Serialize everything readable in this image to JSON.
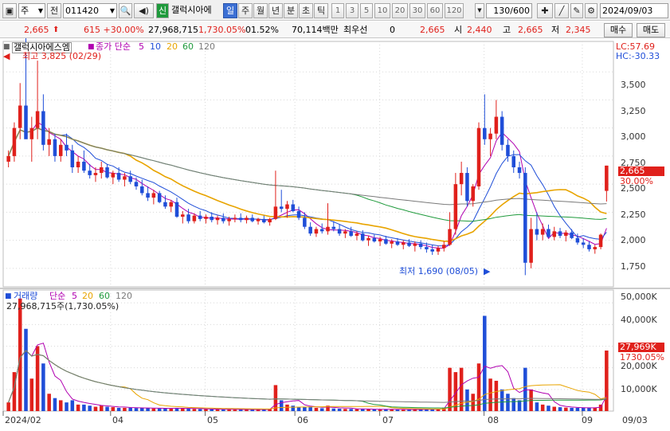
{
  "toolbar": {
    "market_type": "주",
    "market_label": "전",
    "code": "011420",
    "new_badge": "신",
    "name": "갤럭시아에",
    "period_tabs": [
      "일",
      "주",
      "월",
      "년",
      "분",
      "초",
      "틱"
    ],
    "active_period": "일",
    "intervals": [
      "1",
      "3",
      "5",
      "10",
      "20",
      "30",
      "60",
      "120"
    ],
    "page_counter": "130/600",
    "date": "2024/09/03"
  },
  "quote": {
    "price": "2,665",
    "change": "615 +30.00%",
    "volume": "27,968,715",
    "volume_ratio": "1,730.05%",
    "turnover_rate": "01.52%",
    "amount": "70,114백만",
    "pref_label": "최우선",
    "pref_value": "0",
    "ask": "2,665",
    "open_label": "시",
    "open": "2,440",
    "high_label": "고",
    "high": "2,665",
    "low_label": "저",
    "low": "2,345",
    "buy_label": "매수",
    "sell_label": "매도"
  },
  "price_pane": {
    "title": "갤럭시아에스엠",
    "indicator_label": "종가 단순",
    "ma_periods": [
      "5",
      "10",
      "20",
      "60",
      "120"
    ],
    "ma_colors": [
      "#b000b0",
      "#1f4ed8",
      "#e8a400",
      "#1f9a3c",
      "#7a7a7a"
    ],
    "lc": "LC:57.69",
    "hc": "HC:-30.33",
    "max_note": "최고 3,825 (02/29)",
    "min_note": "최저 1,690 (08/05)",
    "price_badge": "2,665",
    "pct_badge": "30.00%",
    "y_ticks": [
      "3,500",
      "3,250",
      "3,000",
      "2,750",
      "2,500",
      "2,250",
      "2,000",
      "1,750"
    ]
  },
  "volume_pane": {
    "title": "거래량",
    "indicator_label": "단순",
    "ma_periods": [
      "5",
      "20",
      "60",
      "120"
    ],
    "ma_colors": [
      "#b000b0",
      "#e8a400",
      "#1f9a3c",
      "#7a7a7a"
    ],
    "summary": "27,968,715주(1,730.05%)",
    "vol_badge": "27,969K",
    "vol_pct": "1730.05%",
    "y_ticks": [
      "50,000K",
      "40,000K",
      "30,000K",
      "20,000K",
      "10,000K"
    ]
  },
  "x_axis": {
    "labels": [
      "2024/02",
      "04",
      "05",
      "06",
      "07",
      "08",
      "09"
    ],
    "right_label": "09/03"
  },
  "colors": {
    "up": "#e0201b",
    "down": "#1f4ed8",
    "grid": "#d8d8d8",
    "badge": "#e0201b"
  },
  "chart_data": {
    "type": "candlestick",
    "price_range": [
      1600,
      3700
    ],
    "volume_range": [
      0,
      53000
    ],
    "candles": [
      [
        2700,
        2800,
        2650,
        2750,
        4000
      ],
      [
        2750,
        3050,
        2700,
        3000,
        18000
      ],
      [
        3000,
        3400,
        2900,
        3200,
        52000
      ],
      [
        3200,
        3825,
        3000,
        2900,
        38000
      ],
      [
        2900,
        3100,
        2700,
        3000,
        15000
      ],
      [
        3000,
        3600,
        2900,
        3150,
        30000
      ],
      [
        3150,
        3300,
        2800,
        2850,
        22000
      ],
      [
        2850,
        3000,
        2750,
        2900,
        8000
      ],
      [
        2900,
        2950,
        2700,
        2750,
        6000
      ],
      [
        2750,
        2900,
        2700,
        2850,
        5000
      ],
      [
        2850,
        2950,
        2750,
        2800,
        4000
      ],
      [
        2800,
        2850,
        2600,
        2650,
        5000
      ],
      [
        2650,
        2750,
        2600,
        2700,
        3000
      ],
      [
        2700,
        2800,
        2600,
        2620,
        3000
      ],
      [
        2620,
        2680,
        2550,
        2580,
        2500
      ],
      [
        2580,
        2650,
        2520,
        2600,
        2000
      ],
      [
        2600,
        2700,
        2550,
        2650,
        2500
      ],
      [
        2650,
        2680,
        2550,
        2560,
        2000
      ],
      [
        2560,
        2620,
        2500,
        2600,
        1800
      ],
      [
        2600,
        2650,
        2520,
        2540,
        1500
      ],
      [
        2540,
        2600,
        2480,
        2570,
        1500
      ],
      [
        2570,
        2620,
        2500,
        2520,
        1500
      ],
      [
        2520,
        2560,
        2450,
        2480,
        1400
      ],
      [
        2480,
        2540,
        2400,
        2420,
        1500
      ],
      [
        2420,
        2480,
        2350,
        2380,
        1300
      ],
      [
        2380,
        2450,
        2320,
        2420,
        1200
      ],
      [
        2420,
        2440,
        2330,
        2340,
        1200
      ],
      [
        2340,
        2400,
        2280,
        2300,
        1300
      ],
      [
        2300,
        2360,
        2250,
        2340,
        1200
      ],
      [
        2340,
        2380,
        2200,
        2210,
        1500
      ],
      [
        2210,
        2260,
        2150,
        2230,
        1200
      ],
      [
        2230,
        2280,
        2150,
        2170,
        1100
      ],
      [
        2170,
        2240,
        2150,
        2220,
        1000
      ],
      [
        2220,
        2260,
        2170,
        2190,
        900
      ],
      [
        2190,
        2230,
        2150,
        2210,
        900
      ],
      [
        2210,
        2250,
        2160,
        2180,
        900
      ],
      [
        2180,
        2220,
        2140,
        2200,
        800
      ],
      [
        2200,
        2240,
        2150,
        2170,
        800
      ],
      [
        2170,
        2210,
        2130,
        2190,
        800
      ],
      [
        2190,
        2230,
        2160,
        2200,
        700
      ],
      [
        2200,
        2240,
        2160,
        2180,
        700
      ],
      [
        2180,
        2220,
        2150,
        2200,
        700
      ],
      [
        2200,
        2230,
        2160,
        2170,
        700
      ],
      [
        2170,
        2200,
        2140,
        2190,
        700
      ],
      [
        2190,
        2220,
        2150,
        2160,
        800
      ],
      [
        2160,
        2200,
        2130,
        2190,
        900
      ],
      [
        2190,
        2620,
        2180,
        2300,
        12000
      ],
      [
        2300,
        2450,
        2250,
        2280,
        5000
      ],
      [
        2280,
        2350,
        2200,
        2320,
        3000
      ],
      [
        2320,
        2360,
        2250,
        2260,
        2500
      ],
      [
        2260,
        2300,
        2180,
        2200,
        2000
      ],
      [
        2200,
        2250,
        2100,
        2120,
        2000
      ],
      [
        2120,
        2160,
        2040,
        2060,
        2000
      ],
      [
        2060,
        2120,
        2030,
        2100,
        1500
      ],
      [
        2100,
        2150,
        2060,
        2080,
        1300
      ],
      [
        2080,
        2330,
        2050,
        2120,
        2500
      ],
      [
        2120,
        2170,
        2080,
        2100,
        1200
      ],
      [
        2100,
        2140,
        2040,
        2060,
        1100
      ],
      [
        2060,
        2100,
        2020,
        2080,
        1000
      ],
      [
        2080,
        2120,
        2030,
        2040,
        1000
      ],
      [
        2040,
        2080,
        2000,
        2060,
        900
      ],
      [
        2060,
        2090,
        1990,
        2000,
        900
      ],
      [
        2000,
        2040,
        1950,
        2020,
        900
      ],
      [
        2020,
        2050,
        1980,
        1990,
        800
      ],
      [
        1990,
        2030,
        1950,
        2010,
        800
      ],
      [
        2010,
        2040,
        1960,
        1970,
        800
      ],
      [
        1970,
        2010,
        1930,
        1990,
        800
      ],
      [
        1990,
        2020,
        1950,
        1960,
        700
      ],
      [
        1960,
        2000,
        1920,
        1980,
        700
      ],
      [
        1980,
        2010,
        1940,
        1950,
        700
      ],
      [
        1950,
        1990,
        1900,
        1970,
        700
      ],
      [
        1970,
        2000,
        1920,
        1940,
        800
      ],
      [
        1940,
        1980,
        1890,
        1920,
        900
      ],
      [
        1920,
        1960,
        1870,
        1900,
        900
      ],
      [
        1900,
        1950,
        1870,
        1930,
        1000
      ],
      [
        1930,
        1990,
        1900,
        1960,
        1500
      ],
      [
        1960,
        2250,
        1950,
        2100,
        20000
      ],
      [
        2100,
        2600,
        2050,
        2500,
        18000
      ],
      [
        2500,
        2700,
        2400,
        2600,
        20000
      ],
      [
        2600,
        2650,
        2300,
        2350,
        10000
      ],
      [
        2350,
        2500,
        2300,
        2480,
        8000
      ],
      [
        2480,
        3050,
        2450,
        3000,
        22000
      ],
      [
        3000,
        3300,
        2850,
        2900,
        44000
      ],
      [
        2900,
        3000,
        2750,
        2950,
        15000
      ],
      [
        2950,
        3250,
        2900,
        3100,
        14000
      ],
      [
        3100,
        3150,
        2800,
        2850,
        10000
      ],
      [
        2850,
        2900,
        2700,
        2750,
        8000
      ],
      [
        2750,
        2800,
        2600,
        2650,
        6000
      ],
      [
        2650,
        2700,
        2550,
        2600,
        5000
      ],
      [
        2600,
        2650,
        1690,
        1800,
        20000
      ],
      [
        1800,
        2200,
        1750,
        2100,
        10000
      ],
      [
        2100,
        2250,
        2000,
        2050,
        4000
      ],
      [
        2050,
        2150,
        2000,
        2100,
        3000
      ],
      [
        2100,
        2140,
        2020,
        2030,
        2500
      ],
      [
        2030,
        2120,
        2000,
        2080,
        2000
      ],
      [
        2080,
        2110,
        2020,
        2040,
        1800
      ],
      [
        2040,
        2090,
        1990,
        2070,
        1600
      ],
      [
        2070,
        2100,
        2010,
        2020,
        1500
      ],
      [
        2020,
        2060,
        1960,
        1980,
        1500
      ],
      [
        1980,
        2020,
        1930,
        1960,
        1500
      ],
      [
        1960,
        1990,
        1900,
        1920,
        1500
      ],
      [
        1920,
        1960,
        1880,
        1940,
        1500
      ],
      [
        1940,
        2060,
        1920,
        2050,
        3000
      ],
      [
        2440,
        2665,
        2345,
        2665,
        27969
      ]
    ]
  }
}
